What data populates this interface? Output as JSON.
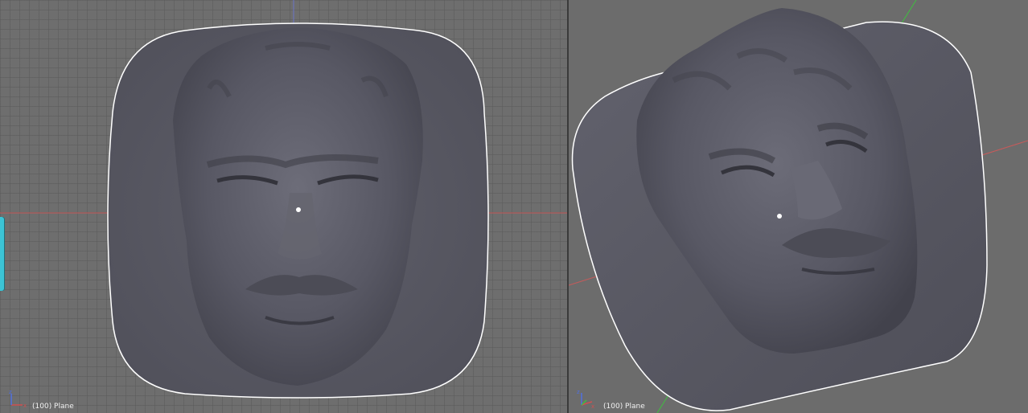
{
  "viewports": {
    "left": {
      "object_label": "(100) Plane",
      "view": "front-orthographic"
    },
    "right": {
      "object_label": "(100) Plane",
      "view": "user-perspective"
    }
  },
  "colors": {
    "grid_background": "#6e6e6e",
    "mesh": "#5a5a66",
    "outline": "#ffffff",
    "x_axis": "#c85a5a",
    "y_axis": "#3fbf3f",
    "side_tab": "#3cc4d6"
  },
  "icons": [
    "axis-gizmo-icon",
    "origin-dot-icon"
  ]
}
